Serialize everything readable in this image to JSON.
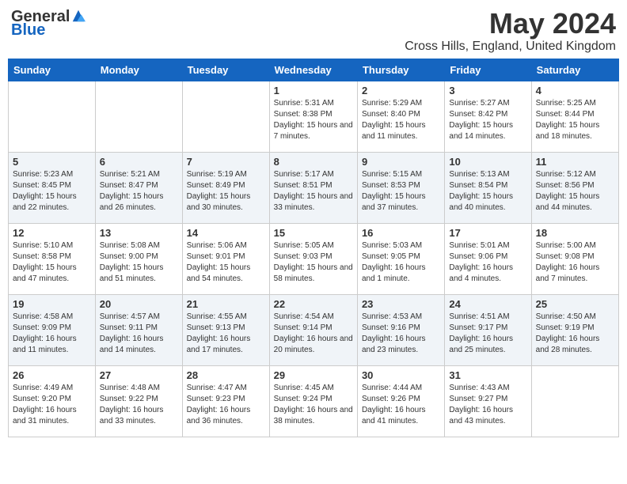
{
  "logo": {
    "general": "General",
    "blue": "Blue"
  },
  "title": "May 2024",
  "location": "Cross Hills, England, United Kingdom",
  "headers": [
    "Sunday",
    "Monday",
    "Tuesday",
    "Wednesday",
    "Thursday",
    "Friday",
    "Saturday"
  ],
  "weeks": [
    [
      {
        "day": "",
        "info": ""
      },
      {
        "day": "",
        "info": ""
      },
      {
        "day": "",
        "info": ""
      },
      {
        "day": "1",
        "info": "Sunrise: 5:31 AM\nSunset: 8:38 PM\nDaylight: 15 hours\nand 7 minutes."
      },
      {
        "day": "2",
        "info": "Sunrise: 5:29 AM\nSunset: 8:40 PM\nDaylight: 15 hours\nand 11 minutes."
      },
      {
        "day": "3",
        "info": "Sunrise: 5:27 AM\nSunset: 8:42 PM\nDaylight: 15 hours\nand 14 minutes."
      },
      {
        "day": "4",
        "info": "Sunrise: 5:25 AM\nSunset: 8:44 PM\nDaylight: 15 hours\nand 18 minutes."
      }
    ],
    [
      {
        "day": "5",
        "info": "Sunrise: 5:23 AM\nSunset: 8:45 PM\nDaylight: 15 hours\nand 22 minutes."
      },
      {
        "day": "6",
        "info": "Sunrise: 5:21 AM\nSunset: 8:47 PM\nDaylight: 15 hours\nand 26 minutes."
      },
      {
        "day": "7",
        "info": "Sunrise: 5:19 AM\nSunset: 8:49 PM\nDaylight: 15 hours\nand 30 minutes."
      },
      {
        "day": "8",
        "info": "Sunrise: 5:17 AM\nSunset: 8:51 PM\nDaylight: 15 hours\nand 33 minutes."
      },
      {
        "day": "9",
        "info": "Sunrise: 5:15 AM\nSunset: 8:53 PM\nDaylight: 15 hours\nand 37 minutes."
      },
      {
        "day": "10",
        "info": "Sunrise: 5:13 AM\nSunset: 8:54 PM\nDaylight: 15 hours\nand 40 minutes."
      },
      {
        "day": "11",
        "info": "Sunrise: 5:12 AM\nSunset: 8:56 PM\nDaylight: 15 hours\nand 44 minutes."
      }
    ],
    [
      {
        "day": "12",
        "info": "Sunrise: 5:10 AM\nSunset: 8:58 PM\nDaylight: 15 hours\nand 47 minutes."
      },
      {
        "day": "13",
        "info": "Sunrise: 5:08 AM\nSunset: 9:00 PM\nDaylight: 15 hours\nand 51 minutes."
      },
      {
        "day": "14",
        "info": "Sunrise: 5:06 AM\nSunset: 9:01 PM\nDaylight: 15 hours\nand 54 minutes."
      },
      {
        "day": "15",
        "info": "Sunrise: 5:05 AM\nSunset: 9:03 PM\nDaylight: 15 hours\nand 58 minutes."
      },
      {
        "day": "16",
        "info": "Sunrise: 5:03 AM\nSunset: 9:05 PM\nDaylight: 16 hours\nand 1 minute."
      },
      {
        "day": "17",
        "info": "Sunrise: 5:01 AM\nSunset: 9:06 PM\nDaylight: 16 hours\nand 4 minutes."
      },
      {
        "day": "18",
        "info": "Sunrise: 5:00 AM\nSunset: 9:08 PM\nDaylight: 16 hours\nand 7 minutes."
      }
    ],
    [
      {
        "day": "19",
        "info": "Sunrise: 4:58 AM\nSunset: 9:09 PM\nDaylight: 16 hours\nand 11 minutes."
      },
      {
        "day": "20",
        "info": "Sunrise: 4:57 AM\nSunset: 9:11 PM\nDaylight: 16 hours\nand 14 minutes."
      },
      {
        "day": "21",
        "info": "Sunrise: 4:55 AM\nSunset: 9:13 PM\nDaylight: 16 hours\nand 17 minutes."
      },
      {
        "day": "22",
        "info": "Sunrise: 4:54 AM\nSunset: 9:14 PM\nDaylight: 16 hours\nand 20 minutes."
      },
      {
        "day": "23",
        "info": "Sunrise: 4:53 AM\nSunset: 9:16 PM\nDaylight: 16 hours\nand 23 minutes."
      },
      {
        "day": "24",
        "info": "Sunrise: 4:51 AM\nSunset: 9:17 PM\nDaylight: 16 hours\nand 25 minutes."
      },
      {
        "day": "25",
        "info": "Sunrise: 4:50 AM\nSunset: 9:19 PM\nDaylight: 16 hours\nand 28 minutes."
      }
    ],
    [
      {
        "day": "26",
        "info": "Sunrise: 4:49 AM\nSunset: 9:20 PM\nDaylight: 16 hours\nand 31 minutes."
      },
      {
        "day": "27",
        "info": "Sunrise: 4:48 AM\nSunset: 9:22 PM\nDaylight: 16 hours\nand 33 minutes."
      },
      {
        "day": "28",
        "info": "Sunrise: 4:47 AM\nSunset: 9:23 PM\nDaylight: 16 hours\nand 36 minutes."
      },
      {
        "day": "29",
        "info": "Sunrise: 4:45 AM\nSunset: 9:24 PM\nDaylight: 16 hours\nand 38 minutes."
      },
      {
        "day": "30",
        "info": "Sunrise: 4:44 AM\nSunset: 9:26 PM\nDaylight: 16 hours\nand 41 minutes."
      },
      {
        "day": "31",
        "info": "Sunrise: 4:43 AM\nSunset: 9:27 PM\nDaylight: 16 hours\nand 43 minutes."
      },
      {
        "day": "",
        "info": ""
      }
    ]
  ]
}
